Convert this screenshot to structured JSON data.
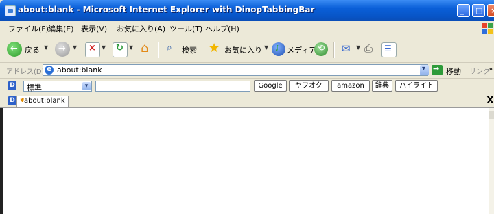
{
  "window": {
    "title": "about:blank - Microsoft Internet Explorer with DinopTabbingBar",
    "controls": [
      "minimize",
      "maximize",
      "close"
    ]
  },
  "menu": [
    "ファイル(F)",
    "編集(E)",
    "表示(V)",
    "お気に入り(A)",
    "ツール(T)",
    "ヘルプ(H)"
  ],
  "toolbar": {
    "back_label": "戻る",
    "search_label": "検索",
    "favorites_label": "お気に入り",
    "media_label": "メディア"
  },
  "address": {
    "label": "アドレス(D)",
    "value": "about:blank",
    "go_label": "移動",
    "links_label": "リンク",
    "more": "»"
  },
  "search_toolbar": {
    "select_value": "標準",
    "query": "",
    "buttons": [
      "Google",
      "ヤフオク",
      "amazon",
      "辞典",
      "ハイライト"
    ]
  },
  "tabs": [
    {
      "label": "about:blank",
      "active": true
    }
  ],
  "tab_close": "X",
  "colors": {
    "titlebar": "#0a5fd8",
    "chrome": "#ece9d8"
  }
}
